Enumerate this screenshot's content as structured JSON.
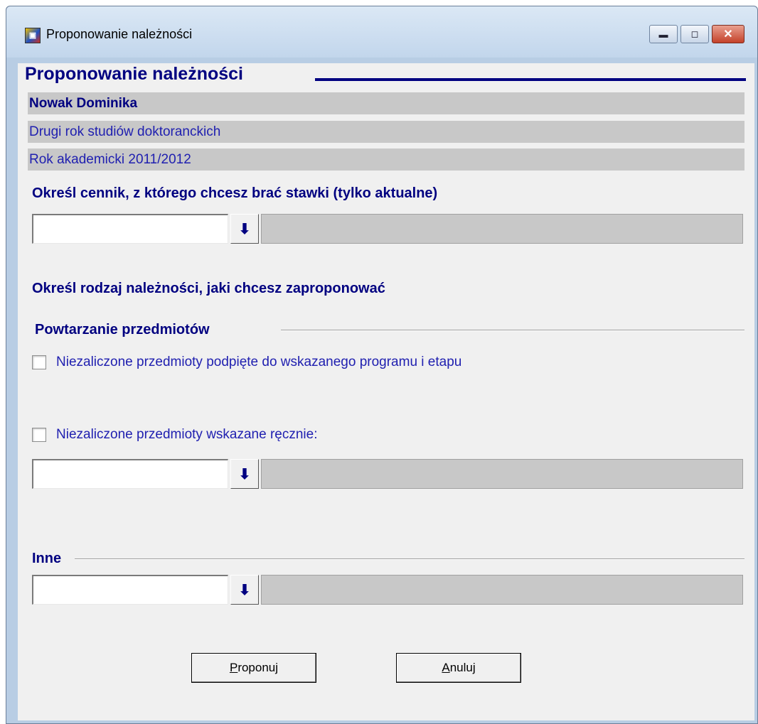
{
  "window": {
    "title": "Proponowanie należności",
    "icon": "app-icon",
    "controls": [
      "minimize-icon",
      "maximize-icon",
      "close-icon"
    ]
  },
  "heading": "Proponowanie należności",
  "info": {
    "name": "Nowak Dominika",
    "study_year": "Drugi rok studiów doktoranckich",
    "academic_year": "Rok akademicki 2011/2012"
  },
  "pricelist": {
    "label": "Określ cennik, z którego chcesz brać stawki (tylko aktualne)",
    "value": "",
    "description": "",
    "button_icon": "arrow-down-icon"
  },
  "fee_type_label": "Określ rodzaj należności, jaki chcesz zaproponować",
  "repeat_group": {
    "label": "Powtarzanie przedmiotów",
    "option1": {
      "label": "Niezaliczone przedmioty podpięte do wskazanego programu i etapu",
      "checked": false
    },
    "option2": {
      "label": "Niezaliczone przedmioty wskazane ręcznie:",
      "checked": false
    },
    "lookup": {
      "value": "",
      "description": ""
    }
  },
  "other_group": {
    "label": "Inne",
    "lookup": {
      "value": "",
      "description": ""
    }
  },
  "buttons": {
    "propose": {
      "mnemonic": "P",
      "rest": "roponuj"
    },
    "cancel": {
      "mnemonic": "A",
      "rest": "nuluj"
    }
  }
}
